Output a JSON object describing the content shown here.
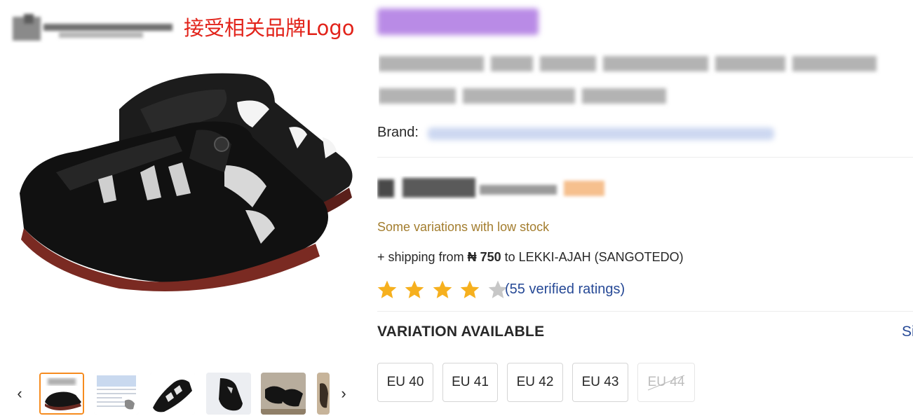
{
  "header": {
    "logo_note": "接受相关品牌Logo"
  },
  "gallery": {
    "main_image": "black-perforated-slip-on-shoes",
    "thumbnails": [
      {
        "name": "thumb-shoes-pair",
        "active": true
      },
      {
        "name": "thumb-size-chart",
        "active": false
      },
      {
        "name": "thumb-single-shoe-angle",
        "active": false
      },
      {
        "name": "thumb-shoe-side",
        "active": false
      },
      {
        "name": "thumb-shoes-top",
        "active": false
      },
      {
        "name": "thumb-partial",
        "active": false
      }
    ],
    "prev_icon": "chevron-left-icon",
    "next_icon": "chevron-right-icon"
  },
  "product": {
    "brand_label": "Brand:",
    "low_stock": "Some variations with low stock",
    "shipping": {
      "prefix": "+ shipping from ",
      "amount": "₦ 750",
      "middle": " to ",
      "location": "LEKKI-AJAH (SANGOTEDO)"
    },
    "rating": {
      "stars_filled": 4,
      "stars_total": 5,
      "label": "(55 verified ratings)"
    },
    "variation": {
      "title": "VARIATION AVAILABLE",
      "size_guide_partial": "Si",
      "sizes": [
        {
          "label": "EU 40",
          "available": true
        },
        {
          "label": "EU 41",
          "available": true
        },
        {
          "label": "EU 42",
          "available": true
        },
        {
          "label": "EU 43",
          "available": true
        },
        {
          "label": "EU 44",
          "available": false
        }
      ]
    }
  },
  "colors": {
    "accent_orange": "#f68b1e",
    "star_gold": "#f6b01e",
    "star_gray": "#c7c7c7",
    "link_blue": "#264996",
    "low_stock_text": "#a37d2e",
    "logo_note_red": "#e2231a",
    "badge_purple": "#b98be6"
  }
}
